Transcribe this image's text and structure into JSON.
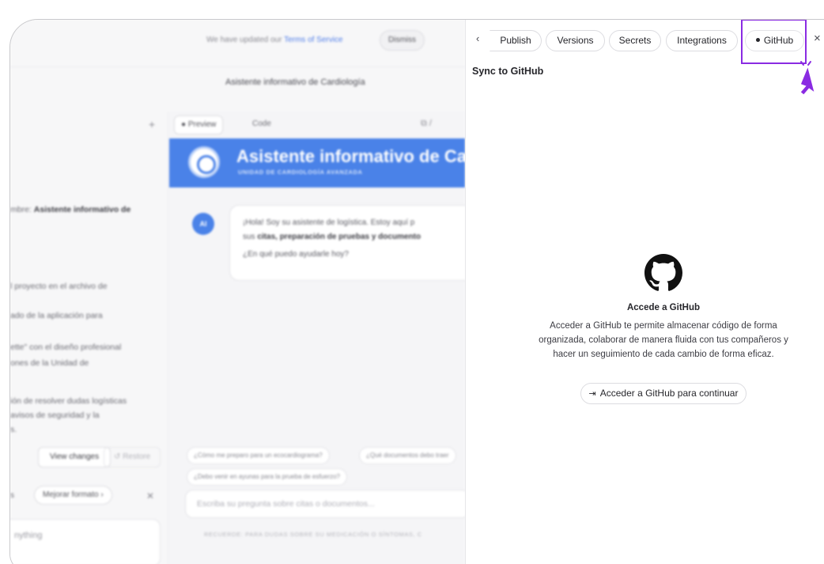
{
  "top": {
    "notice_text": "We have updated our",
    "notice_link": "Terms of Service",
    "dismiss_label": "Dismiss",
    "project_title": "Asistente informativo de Cardiología"
  },
  "chat": {
    "lines": [
      "mbre: Asistente informativo de",
      "l proyecto en el archivo de",
      "ado de la aplicación para",
      "ette\" con el diseño profesional",
      "ones de la Unidad de",
      "ión de resolver dudas logísticas",
      "avisos de seguridad y la",
      "s."
    ],
    "view_changes_label": "View changes",
    "restore_label": "↺ Restore",
    "row_label": "s",
    "mejorar_label": "Mejorar formato  ›",
    "anything_placeholder": "nything"
  },
  "preview": {
    "tab_preview": "● Preview",
    "tab_code": "Code",
    "hero_title": "Asistente informativo de Car",
    "hero_subtitle": "UNIDAD DE CARDIOLOGÍA AVANZADA",
    "ai_badge": "AI",
    "bubble_line1": "¡Hola! Soy su asistente de logística. Estoy aquí p",
    "bubble_line2_pre": "sus ",
    "bubble_line2_bold": "citas, preparación de pruebas y documento",
    "bubble_line3": "¿En qué puedo ayudarle hoy?",
    "suggestions": [
      "¿Cómo me preparo para un ecocardiograma?",
      "¿Qué documentos debo traer",
      "¿Debo venir en ayunas para la prueba de esfuerzo?"
    ],
    "input_placeholder": "Escriba su pregunta sobre citas o documentos...",
    "disclaimer": "RECUERDE: PARA DUDAS SOBRE SU MEDICACIÓN O SÍNTOMAS, C"
  },
  "panel": {
    "tabs": {
      "back": "‹",
      "publish": "Publish",
      "versions": "Versions",
      "secrets": "Secrets",
      "integrations": "Integrations",
      "github": "GitHub",
      "close": "×"
    },
    "sync_title": "Sync to GitHub",
    "access_title": "Accede a GitHub",
    "access_desc": "Acceder a GitHub te permite almacenar código de forma organizada, colaborar de manera fluida con tus compañeros y hacer un seguimiento de cada cambio de forma eficaz.",
    "access_button_icon": "⇥",
    "access_button": "Acceder a GitHub para continuar"
  },
  "colors": {
    "accent_highlight": "#8a2be2",
    "hero_blue": "#4a82e8",
    "cursor": "#8a2be2"
  },
  "icons": [
    "github-icon",
    "login-icon",
    "heart-logo-icon",
    "pointer-cursor-icon"
  ]
}
